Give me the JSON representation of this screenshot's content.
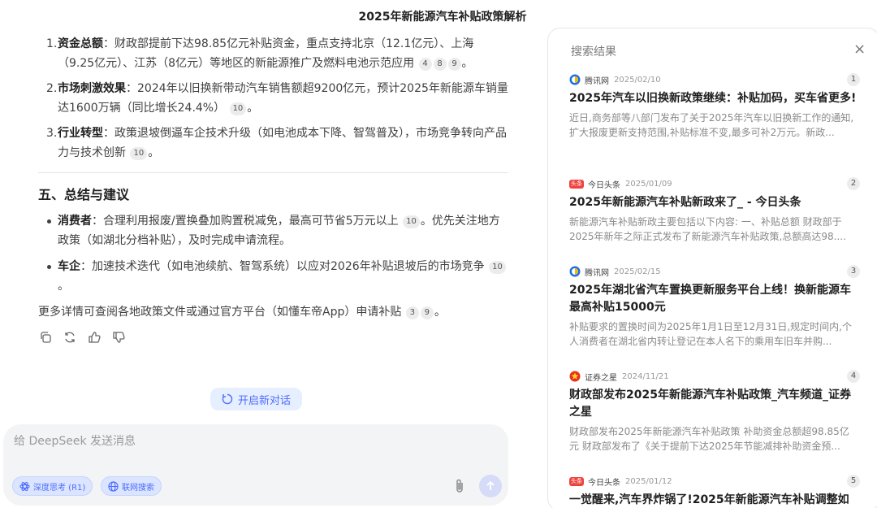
{
  "page_title": "2025年新能源汽车补贴政策解析",
  "chat": {
    "numbered": [
      {
        "num": "1.",
        "label": "资金总额",
        "text": "：财政部提前下达98.85亿元补贴资金，重点支持北京（12.1亿元）、上海（9.25亿元）、江苏（8亿元）等地区的新能源推广及燃料电池示范应用",
        "cites": [
          "4",
          "8",
          "9"
        ],
        "tail": "。"
      },
      {
        "num": "2.",
        "label": "市场刺激效果",
        "text": "：2024年以旧换新带动汽车销售额超9200亿元，预计2025年新能源车销量达1600万辆（同比增长24.4%）",
        "cites": [
          "10"
        ],
        "tail": "。"
      },
      {
        "num": "3.",
        "label": "行业转型",
        "text": "：政策退坡倒逼车企技术升级（如电池成本下降、智驾普及），市场竞争转向产品力与技术创新",
        "cites": [
          "10"
        ],
        "tail": "。"
      }
    ],
    "section_title": "五、总结与建议",
    "bullets": [
      {
        "label": "消费者",
        "text": "：合理利用报废/置换叠加购置税减免，最高可节省5万元以上",
        "cite": "10",
        "after": "。优先关注地方政策（如湖北分档补贴），及时完成申请流程。"
      },
      {
        "label": "车企",
        "text": "：加速技术迭代（如电池续航、智驾系统）以应对2026年补贴退坡后的市场竞争",
        "cite": "10",
        "after": "。"
      }
    ],
    "more": {
      "text": "更多详情可查阅各地政策文件或通过官方平台（如懂车帝App）申请补贴",
      "cites": [
        "3",
        "9"
      ],
      "tail": "。"
    }
  },
  "new_chat_label": "开启新对话",
  "composer": {
    "placeholder": "给 DeepSeek 发送消息",
    "deep_think_label": "深度思考 (R1)",
    "web_search_label": "联网搜索"
  },
  "search_panel": {
    "title": "搜索结果",
    "results": [
      {
        "source": "腾讯网",
        "date": "2025/02/10",
        "index": "1",
        "logo": "tencent",
        "title": "2025年汽车以旧换新政策继续：补贴加码，买车省更多!",
        "snippet": "近日,商务部等八部门发布了关于2025年汽车以旧换新工作的通知,扩大报废更新支持范围,补贴标准不变,最多可补2万元。新政..."
      },
      {
        "source": "今日头条",
        "date": "2025/01/09",
        "index": "2",
        "logo": "toutiao",
        "logo_text": "头条",
        "title": "2025年新能源汽车补贴新政来了_ - 今日头条",
        "snippet": "新能源汽车补贴新政主要包括以下内容: 一、补贴总额 财政部于2025年新年之际正式发布了新能源汽车补贴政策,总额高达98...."
      },
      {
        "source": "腾讯网",
        "date": "2025/02/15",
        "index": "3",
        "logo": "tencent",
        "title": "2025年湖北省汽车置换更新服务平台上线！换新能源车最高补贴15000元",
        "snippet": "补贴要求的置换时间为2025年1月1日至12月31日,规定时间内,个人消费者在湖北省内转让登记在本人名下的乘用车旧车并购..."
      },
      {
        "source": "证券之星",
        "date": "2024/11/21",
        "index": "4",
        "logo": "star",
        "title": "财政部发布2025年新能源汽车补贴政策_汽车频道_证券之星",
        "snippet": "财政部发布2025年新能源汽车补贴政策 补助资金总额超98.85亿元 财政部发布了《关于提前下达2025年节能减排补助资金预..."
      },
      {
        "source": "今日头条",
        "date": "2025/01/12",
        "index": "5",
        "logo": "toutiao",
        "logo_text": "头条",
        "title": "一觉醒来,汽车界炸锅了!2025年新能源汽车补贴调整如",
        "snippet": ""
      }
    ]
  },
  "colors": {
    "accent": "#4d6bfe",
    "chip_bg": "#dbe5ff",
    "toutiao_red": "#f0433f"
  }
}
